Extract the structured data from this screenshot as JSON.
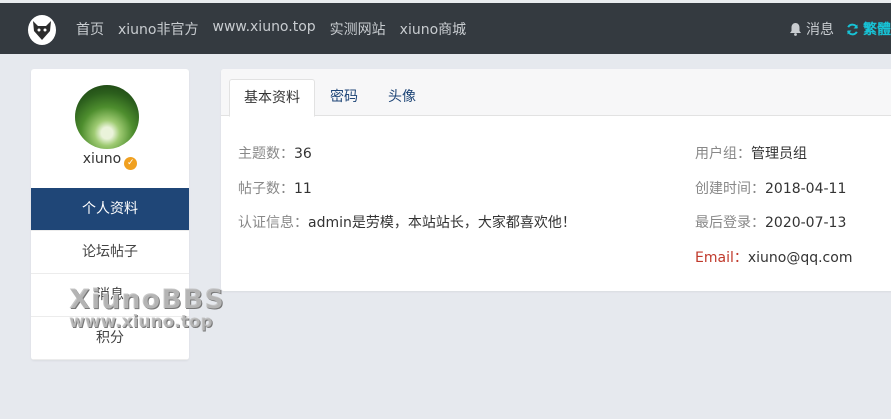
{
  "topbar": {
    "nav": [
      "首页",
      "xiuno非官方",
      "www.xiuno.top",
      "实测网站",
      "xiuno商城"
    ],
    "message_label": "消息",
    "lang_label": "繁體"
  },
  "profile": {
    "username": "xiuno",
    "menu": [
      "个人资料",
      "论坛帖子",
      "消息",
      "积分"
    ]
  },
  "tabs": [
    "基本资料",
    "密码",
    "头像"
  ],
  "info_left": [
    {
      "key": "主题数：",
      "value": "36"
    },
    {
      "key": "帖子数：",
      "value": "11"
    },
    {
      "key": "认证信息：",
      "value": "admin是劳模，本站站长，大家都喜欢他！"
    }
  ],
  "info_right": [
    {
      "key": "用户组：",
      "value": "管理员组"
    },
    {
      "key": "创建时间：",
      "value": "2018-04-11"
    },
    {
      "key": "最后登录：",
      "value": "2020-07-13"
    },
    {
      "key": "Email：",
      "value": "xiuno@qq.com"
    }
  ],
  "watermark": {
    "line1": "XiunoBBS",
    "line2": "www.xiuno.top"
  },
  "colors": {
    "topbar": "#343a40",
    "active_menu": "#1f4677",
    "lang": "#17c3d6",
    "email_label": "#c0392b"
  }
}
